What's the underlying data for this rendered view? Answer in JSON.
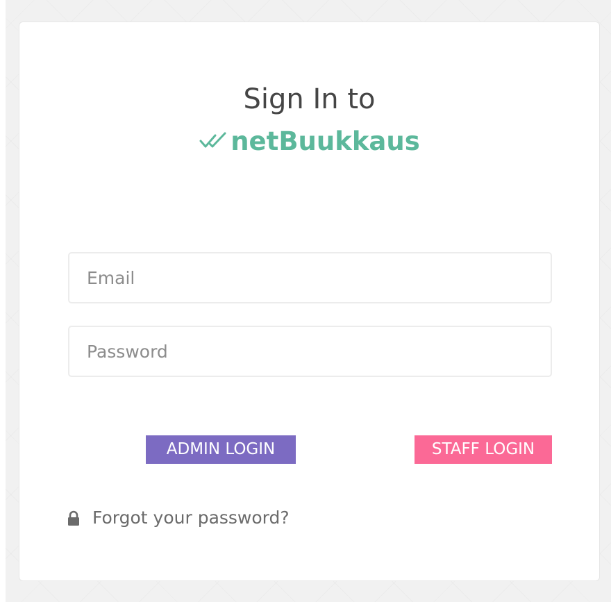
{
  "heading": {
    "title": "Sign In to",
    "brand_name": "netBuukkaus",
    "brand_icon": "double-check-icon"
  },
  "form": {
    "email": {
      "placeholder": "Email",
      "value": ""
    },
    "password": {
      "placeholder": "Password",
      "value": ""
    }
  },
  "buttons": {
    "admin_label": "ADMIN LOGIN",
    "staff_label": "STAFF LOGIN"
  },
  "forgot": {
    "label": "Forgot your password?",
    "icon": "lock-icon"
  },
  "colors": {
    "brand": "#5cb89b",
    "admin_button": "#7c6bc2",
    "staff_button": "#fb6996",
    "page_background": "#f1f1f1"
  }
}
